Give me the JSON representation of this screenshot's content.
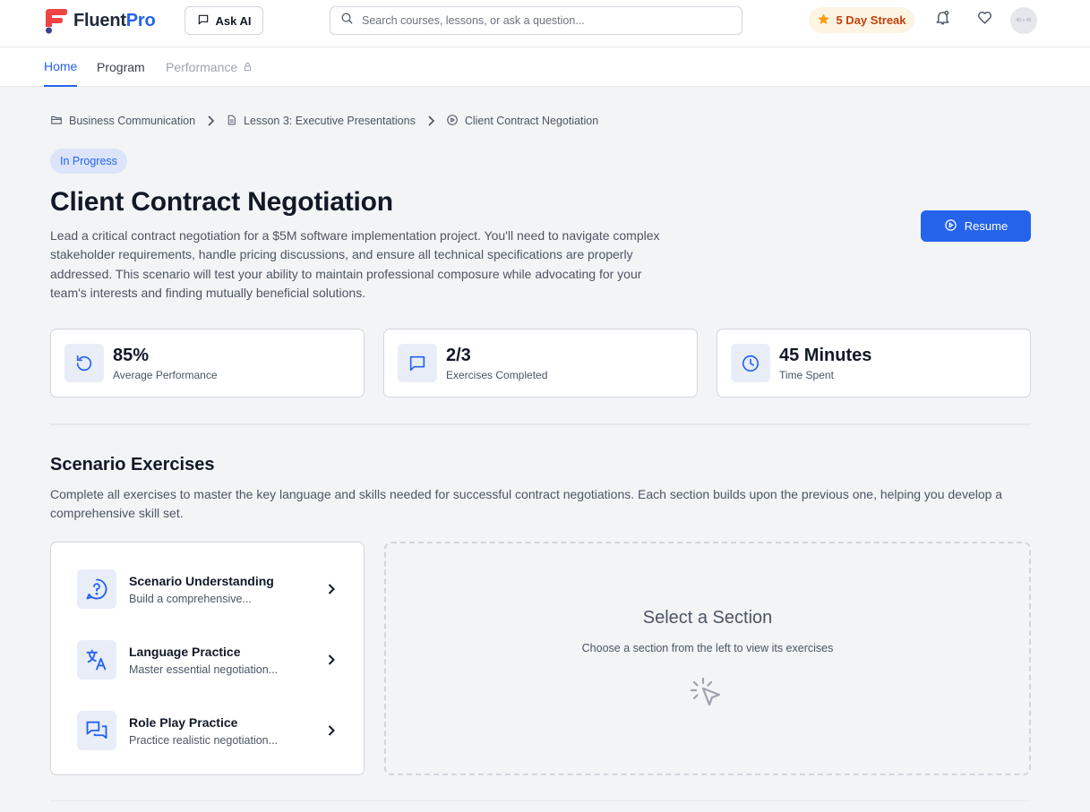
{
  "app": {
    "brand_part1": "Fluent",
    "brand_part2": "Pro",
    "ask_ai_label": "Ask AI",
    "search_placeholder": "Search courses, lessons, or ask a question...",
    "streak_label": "5 Day Streak",
    "avatar_text": "40 × 40"
  },
  "nav": {
    "tabs": [
      {
        "label": "Home",
        "state": "active"
      },
      {
        "label": "Program",
        "state": "normal"
      },
      {
        "label": "Performance",
        "state": "locked"
      }
    ]
  },
  "breadcrumb": [
    {
      "label": "Business Communication",
      "icon": "folder-icon"
    },
    {
      "label": "Lesson 3: Executive Presentations",
      "icon": "document-icon"
    },
    {
      "label": "Client Contract Negotiation",
      "icon": "play-circle-icon"
    }
  ],
  "scenario": {
    "status": "In Progress",
    "title": "Client Contract Negotiation",
    "description": "Lead a critical contract negotiation for a $5M software implementation project. You'll need to navigate complex stakeholder requirements, handle pricing discussions, and ensure all technical specifications are properly addressed. This scenario will test your ability to maintain professional composure while advocating for your team's interests and finding mutually beneficial solutions.",
    "resume_label": "Resume"
  },
  "stats": [
    {
      "value": "85%",
      "label": "Average Performance",
      "icon": "refresh-icon"
    },
    {
      "value": "2/3",
      "label": "Exercises Completed",
      "icon": "chat-icon"
    },
    {
      "value": "45 Minutes",
      "label": "Time Spent",
      "icon": "clock-icon"
    }
  ],
  "exercises": {
    "title": "Scenario Exercises",
    "description": "Complete all exercises to master the key language and skills needed for successful contract negotiations. Each section builds upon the previous one, helping you develop a comprehensive skill set.",
    "items": [
      {
        "title": "Scenario Understanding",
        "subtitle": "Build a comprehensive...",
        "icon": "question-bubble-icon"
      },
      {
        "title": "Language Practice",
        "subtitle": "Master essential negotiation...",
        "icon": "translate-icon"
      },
      {
        "title": "Role Play Practice",
        "subtitle": "Practice realistic negotiation...",
        "icon": "conversation-icon"
      }
    ]
  },
  "select_panel": {
    "title": "Select a Section",
    "subtitle": "Choose a section from the left to view its exercises",
    "icon": "pointer-click-icon"
  },
  "colors": {
    "accent": "#2563eb",
    "streak_text": "#c2410c",
    "streak_bg": "#fdf4e3",
    "status_bg": "#dbe4f8"
  }
}
